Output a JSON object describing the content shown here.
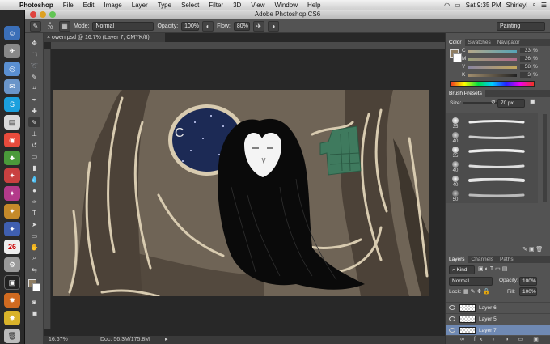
{
  "menubar": {
    "app": "Photoshop",
    "items": [
      "File",
      "Edit",
      "Image",
      "Layer",
      "Type",
      "Select",
      "Filter",
      "3D",
      "View",
      "Window",
      "Help"
    ],
    "clock": "Sat 9:35 PM",
    "user": "Shirley!"
  },
  "window": {
    "title": "Adobe Photoshop CS6"
  },
  "options": {
    "brush_size": "70",
    "mode_label": "Mode:",
    "mode_value": "Normal",
    "opacity_label": "Opacity:",
    "opacity_value": "100%",
    "flow_label": "Flow:",
    "flow_value": "80%",
    "workspace": "Painting"
  },
  "document": {
    "tab": "owen.psd @ 16.7% (Layer 7, CMYK/8)",
    "zoom": "16.67%",
    "doc_size": "Doc: 56.3M/175.8M"
  },
  "color_panel": {
    "tabs": [
      "Color",
      "Swatches",
      "Navigator"
    ],
    "channels": [
      {
        "label": "C",
        "value": "33",
        "unit": "%"
      },
      {
        "label": "M",
        "value": "36",
        "unit": "%"
      },
      {
        "label": "Y",
        "value": "58",
        "unit": "%"
      },
      {
        "label": "K",
        "value": "3",
        "unit": "%"
      }
    ],
    "fg_color": "#8e7d62"
  },
  "brush_presets": {
    "title": "Brush Presets",
    "size_label": "Size:",
    "size_value": "70 px",
    "sizes": [
      "35",
      "40",
      "35",
      "40",
      "40",
      "50"
    ]
  },
  "layers_panel": {
    "tabs": [
      "Layers",
      "Channels",
      "Paths"
    ],
    "kind_label": "Kind",
    "blend_mode": "Normal",
    "opacity_label": "Opacity:",
    "opacity_value": "100%",
    "lock_label": "Lock:",
    "fill_label": "Fill:",
    "fill_value": "100%",
    "layers": [
      "Layer 6",
      "Layer 5",
      "Layer 7"
    ],
    "selected": "Layer 7"
  },
  "colors": {
    "bg_brown": "#6f6456",
    "owl_black": "#0a0a0a",
    "window_blue": "#1c2a55",
    "green_hand": "#3f7a5e"
  }
}
